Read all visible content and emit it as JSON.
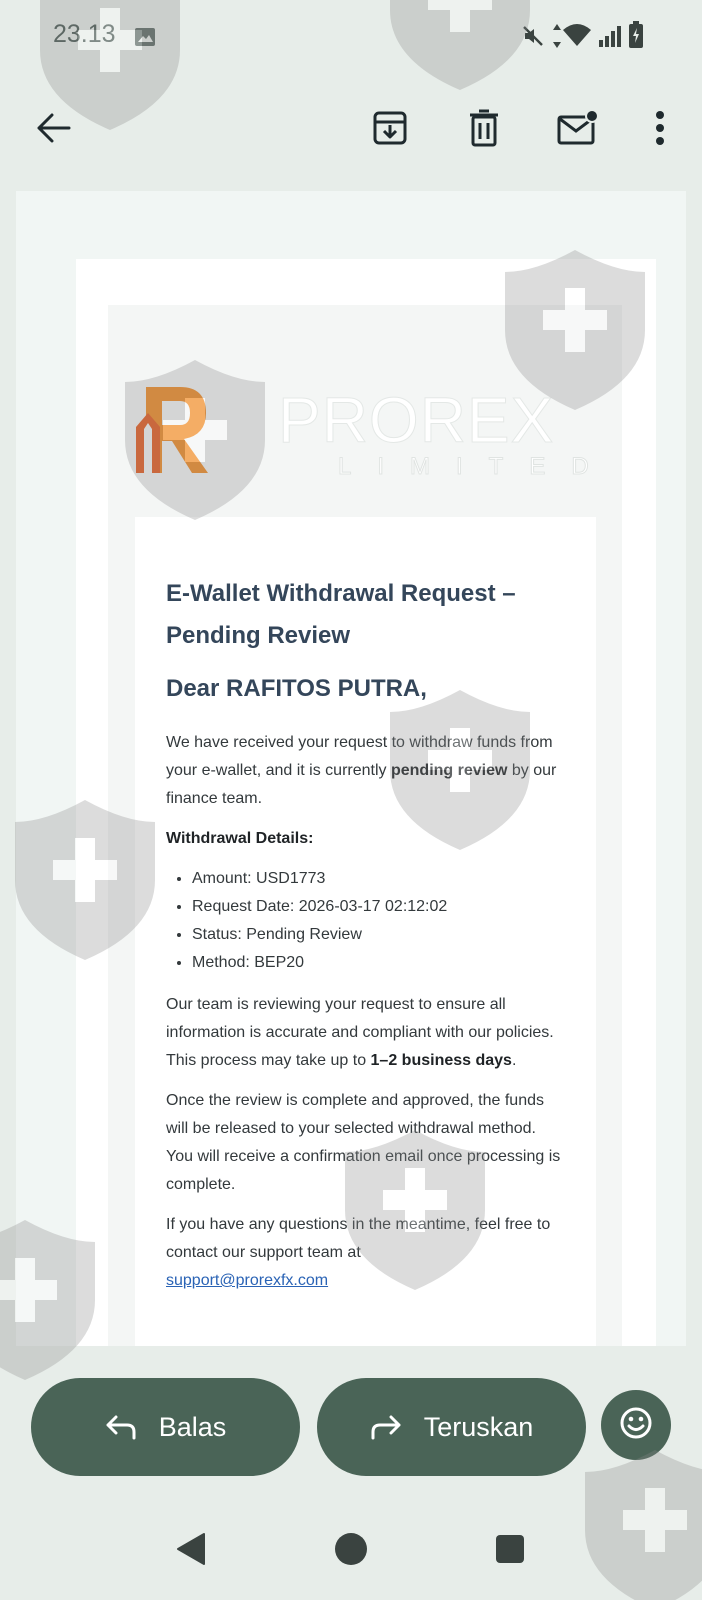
{
  "status_bar": {
    "time": "23.13",
    "icons": [
      "gallery-icon",
      "mute-icon",
      "data-arrows-icon",
      "wifi-icon",
      "signal-icon",
      "battery-icon"
    ]
  },
  "app_bar": {
    "icons": [
      "back-arrow-icon",
      "archive-icon",
      "delete-icon",
      "mark-unread-icon",
      "more-vert-icon"
    ]
  },
  "email": {
    "logo": {
      "brand": "PROREX",
      "sub": "LIMITED",
      "accent": "#f08a24"
    },
    "title": "E-Wallet Withdrawal Request – Pending Review",
    "greeting": "Dear RAFITOS PUTRA,",
    "intro_before": "We have received your request to withdraw funds from your e-wallet, and it is currently ",
    "intro_bold": "pending review",
    "intro_after": " by our finance team.",
    "details_heading": "Withdrawal Details:",
    "details": [
      "Amount: USD1773",
      "Request Date: 2026-03-17 02:12:02",
      "Status: Pending Review",
      "Method: BEP20"
    ],
    "review_before": "Our team is reviewing your request to ensure all information is accurate and compliant with our policies. This process may take up to ",
    "review_bold": "1–2 business days",
    "review_after": ".",
    "release_text": "Once the review is complete and approved, the funds will be released to your selected withdrawal method. You will receive a confirmation email once processing is complete.",
    "questions_text": "If you have any questions in the meantime, feel free to contact our support team at",
    "support_email": "support@prorexfx.com"
  },
  "actions": {
    "reply_label": "Balas",
    "forward_label": "Teruskan",
    "accent": "#4a6457"
  },
  "nav_bar": {
    "icons": [
      "back-triangle-icon",
      "home-circle-icon",
      "recents-square-icon"
    ]
  }
}
